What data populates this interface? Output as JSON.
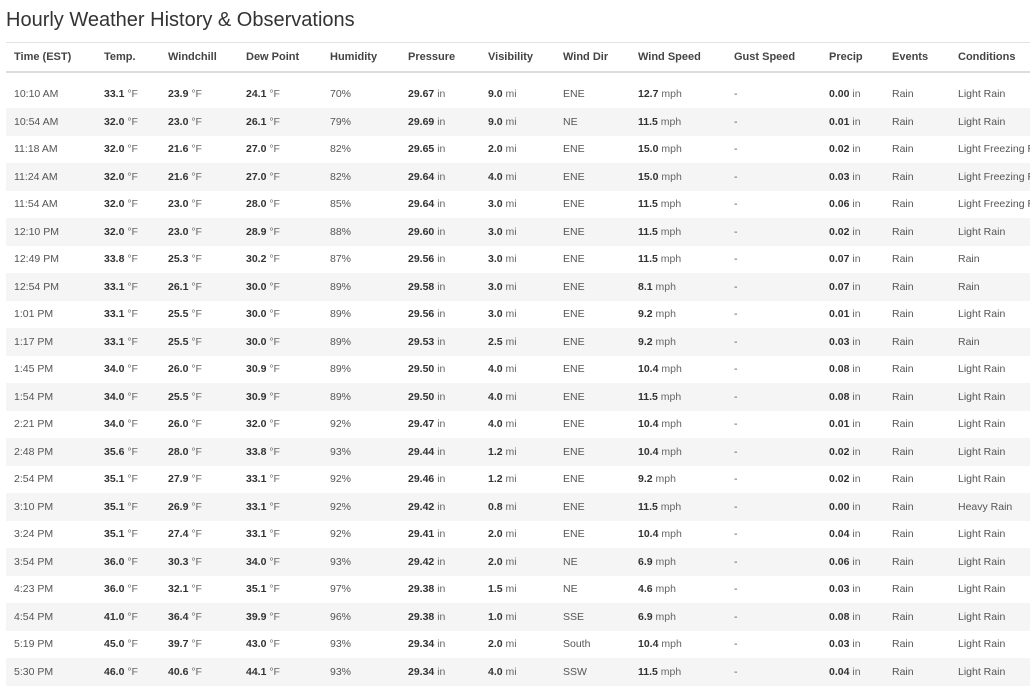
{
  "page": {
    "title": "Hourly Weather History & Observations"
  },
  "table": {
    "columns": [
      {
        "key": "time",
        "label": "Time (EST)"
      },
      {
        "key": "temp",
        "label": "Temp."
      },
      {
        "key": "windchill",
        "label": "Windchill"
      },
      {
        "key": "dewpoint",
        "label": "Dew Point"
      },
      {
        "key": "humidity",
        "label": "Humidity"
      },
      {
        "key": "pressure",
        "label": "Pressure"
      },
      {
        "key": "visibility",
        "label": "Visibility"
      },
      {
        "key": "winddir",
        "label": "Wind Dir"
      },
      {
        "key": "windspeed",
        "label": "Wind Speed"
      },
      {
        "key": "gust",
        "label": "Gust Speed"
      },
      {
        "key": "precip",
        "label": "Precip"
      },
      {
        "key": "events",
        "label": "Events"
      },
      {
        "key": "conditions",
        "label": "Conditions"
      }
    ],
    "units": {
      "temp": "°F",
      "pressure": "in",
      "visibility": "mi",
      "windspeed": "mph",
      "precip": "in"
    },
    "rows": [
      {
        "time": "10:10 AM",
        "temp": "33.1",
        "windchill": "23.9",
        "dewpoint": "24.1",
        "humidity": "70%",
        "pressure": "29.67",
        "visibility": "9.0",
        "winddir": "ENE",
        "windspeed": "12.7",
        "gust": "-",
        "precip": "0.00",
        "events": "Rain",
        "conditions": "Light Rain"
      },
      {
        "time": "10:54 AM",
        "temp": "32.0",
        "windchill": "23.0",
        "dewpoint": "26.1",
        "humidity": "79%",
        "pressure": "29.69",
        "visibility": "9.0",
        "winddir": "NE",
        "windspeed": "11.5",
        "gust": "-",
        "precip": "0.01",
        "events": "Rain",
        "conditions": "Light Rain"
      },
      {
        "time": "11:18 AM",
        "temp": "32.0",
        "windchill": "21.6",
        "dewpoint": "27.0",
        "humidity": "82%",
        "pressure": "29.65",
        "visibility": "2.0",
        "winddir": "ENE",
        "windspeed": "15.0",
        "gust": "-",
        "precip": "0.02",
        "events": "Rain",
        "conditions": "Light Freezing Rain"
      },
      {
        "time": "11:24 AM",
        "temp": "32.0",
        "windchill": "21.6",
        "dewpoint": "27.0",
        "humidity": "82%",
        "pressure": "29.64",
        "visibility": "4.0",
        "winddir": "ENE",
        "windspeed": "15.0",
        "gust": "-",
        "precip": "0.03",
        "events": "Rain",
        "conditions": "Light Freezing Rain"
      },
      {
        "time": "11:54 AM",
        "temp": "32.0",
        "windchill": "23.0",
        "dewpoint": "28.0",
        "humidity": "85%",
        "pressure": "29.64",
        "visibility": "3.0",
        "winddir": "ENE",
        "windspeed": "11.5",
        "gust": "-",
        "precip": "0.06",
        "events": "Rain",
        "conditions": "Light Freezing Rain"
      },
      {
        "time": "12:10 PM",
        "temp": "32.0",
        "windchill": "23.0",
        "dewpoint": "28.9",
        "humidity": "88%",
        "pressure": "29.60",
        "visibility": "3.0",
        "winddir": "ENE",
        "windspeed": "11.5",
        "gust": "-",
        "precip": "0.02",
        "events": "Rain",
        "conditions": "Light Rain"
      },
      {
        "time": "12:49 PM",
        "temp": "33.8",
        "windchill": "25.3",
        "dewpoint": "30.2",
        "humidity": "87%",
        "pressure": "29.56",
        "visibility": "3.0",
        "winddir": "ENE",
        "windspeed": "11.5",
        "gust": "-",
        "precip": "0.07",
        "events": "Rain",
        "conditions": "Rain"
      },
      {
        "time": "12:54 PM",
        "temp": "33.1",
        "windchill": "26.1",
        "dewpoint": "30.0",
        "humidity": "89%",
        "pressure": "29.58",
        "visibility": "3.0",
        "winddir": "ENE",
        "windspeed": "8.1",
        "gust": "-",
        "precip": "0.07",
        "events": "Rain",
        "conditions": "Rain"
      },
      {
        "time": "1:01 PM",
        "temp": "33.1",
        "windchill": "25.5",
        "dewpoint": "30.0",
        "humidity": "89%",
        "pressure": "29.56",
        "visibility": "3.0",
        "winddir": "ENE",
        "windspeed": "9.2",
        "gust": "-",
        "precip": "0.01",
        "events": "Rain",
        "conditions": "Light Rain"
      },
      {
        "time": "1:17 PM",
        "temp": "33.1",
        "windchill": "25.5",
        "dewpoint": "30.0",
        "humidity": "89%",
        "pressure": "29.53",
        "visibility": "2.5",
        "winddir": "ENE",
        "windspeed": "9.2",
        "gust": "-",
        "precip": "0.03",
        "events": "Rain",
        "conditions": "Rain"
      },
      {
        "time": "1:45 PM",
        "temp": "34.0",
        "windchill": "26.0",
        "dewpoint": "30.9",
        "humidity": "89%",
        "pressure": "29.50",
        "visibility": "4.0",
        "winddir": "ENE",
        "windspeed": "10.4",
        "gust": "-",
        "precip": "0.08",
        "events": "Rain",
        "conditions": "Light Rain"
      },
      {
        "time": "1:54 PM",
        "temp": "34.0",
        "windchill": "25.5",
        "dewpoint": "30.9",
        "humidity": "89%",
        "pressure": "29.50",
        "visibility": "4.0",
        "winddir": "ENE",
        "windspeed": "11.5",
        "gust": "-",
        "precip": "0.08",
        "events": "Rain",
        "conditions": "Light Rain"
      },
      {
        "time": "2:21 PM",
        "temp": "34.0",
        "windchill": "26.0",
        "dewpoint": "32.0",
        "humidity": "92%",
        "pressure": "29.47",
        "visibility": "4.0",
        "winddir": "ENE",
        "windspeed": "10.4",
        "gust": "-",
        "precip": "0.01",
        "events": "Rain",
        "conditions": "Light Rain"
      },
      {
        "time": "2:48 PM",
        "temp": "35.6",
        "windchill": "28.0",
        "dewpoint": "33.8",
        "humidity": "93%",
        "pressure": "29.44",
        "visibility": "1.2",
        "winddir": "ENE",
        "windspeed": "10.4",
        "gust": "-",
        "precip": "0.02",
        "events": "Rain",
        "conditions": "Light Rain"
      },
      {
        "time": "2:54 PM",
        "temp": "35.1",
        "windchill": "27.9",
        "dewpoint": "33.1",
        "humidity": "92%",
        "pressure": "29.46",
        "visibility": "1.2",
        "winddir": "ENE",
        "windspeed": "9.2",
        "gust": "-",
        "precip": "0.02",
        "events": "Rain",
        "conditions": "Light Rain"
      },
      {
        "time": "3:10 PM",
        "temp": "35.1",
        "windchill": "26.9",
        "dewpoint": "33.1",
        "humidity": "92%",
        "pressure": "29.42",
        "visibility": "0.8",
        "winddir": "ENE",
        "windspeed": "11.5",
        "gust": "-",
        "precip": "0.00",
        "events": "Rain",
        "conditions": "Heavy Rain"
      },
      {
        "time": "3:24 PM",
        "temp": "35.1",
        "windchill": "27.4",
        "dewpoint": "33.1",
        "humidity": "92%",
        "pressure": "29.41",
        "visibility": "2.0",
        "winddir": "ENE",
        "windspeed": "10.4",
        "gust": "-",
        "precip": "0.04",
        "events": "Rain",
        "conditions": "Light Rain"
      },
      {
        "time": "3:54 PM",
        "temp": "36.0",
        "windchill": "30.3",
        "dewpoint": "34.0",
        "humidity": "93%",
        "pressure": "29.42",
        "visibility": "2.0",
        "winddir": "NE",
        "windspeed": "6.9",
        "gust": "-",
        "precip": "0.06",
        "events": "Rain",
        "conditions": "Light Rain"
      },
      {
        "time": "4:23 PM",
        "temp": "36.0",
        "windchill": "32.1",
        "dewpoint": "35.1",
        "humidity": "97%",
        "pressure": "29.38",
        "visibility": "1.5",
        "winddir": "NE",
        "windspeed": "4.6",
        "gust": "-",
        "precip": "0.03",
        "events": "Rain",
        "conditions": "Light Rain"
      },
      {
        "time": "4:54 PM",
        "temp": "41.0",
        "windchill": "36.4",
        "dewpoint": "39.9",
        "humidity": "96%",
        "pressure": "29.38",
        "visibility": "1.0",
        "winddir": "SSE",
        "windspeed": "6.9",
        "gust": "-",
        "precip": "0.08",
        "events": "Rain",
        "conditions": "Light Rain"
      },
      {
        "time": "5:19 PM",
        "temp": "45.0",
        "windchill": "39.7",
        "dewpoint": "43.0",
        "humidity": "93%",
        "pressure": "29.34",
        "visibility": "2.0",
        "winddir": "South",
        "windspeed": "10.4",
        "gust": "-",
        "precip": "0.03",
        "events": "Rain",
        "conditions": "Light Rain"
      },
      {
        "time": "5:30 PM",
        "temp": "46.0",
        "windchill": "40.6",
        "dewpoint": "44.1",
        "humidity": "93%",
        "pressure": "29.34",
        "visibility": "4.0",
        "winddir": "SSW",
        "windspeed": "11.5",
        "gust": "-",
        "precip": "0.04",
        "events": "Rain",
        "conditions": "Light Rain"
      }
    ]
  }
}
